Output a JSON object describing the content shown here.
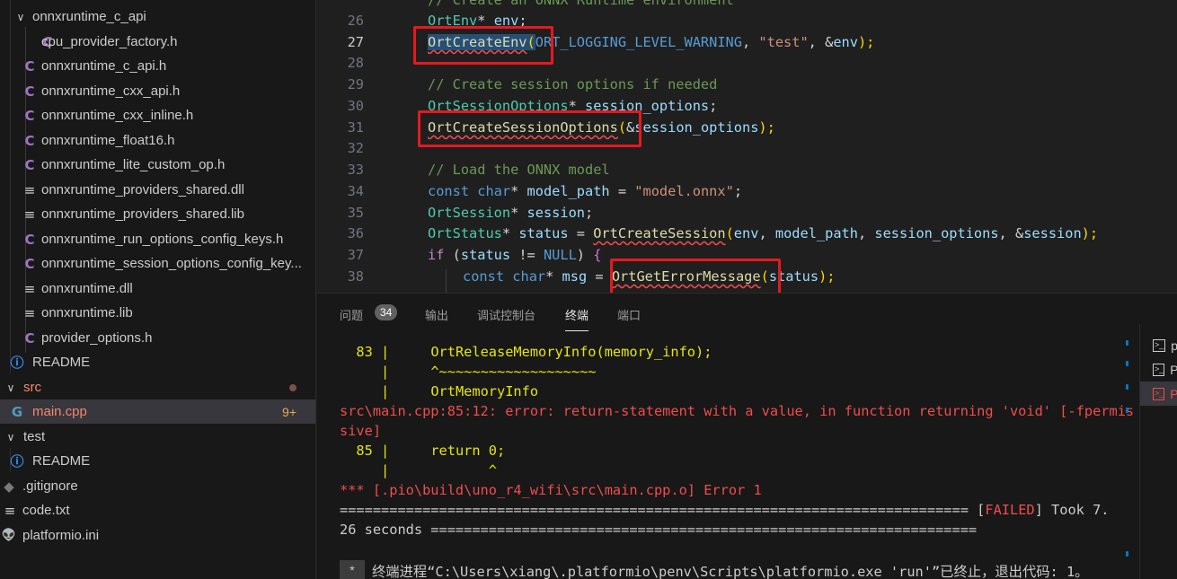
{
  "sidebar": {
    "items": [
      {
        "label": "onnxruntime_c_api",
        "kind": "folder-open",
        "icon": "chevron-down-icon"
      },
      {
        "label": "cpu_provider_factory.h",
        "kind": "c"
      },
      {
        "label": "onnxruntime_c_api.h",
        "kind": "c"
      },
      {
        "label": "onnxruntime_cxx_api.h",
        "kind": "c"
      },
      {
        "label": "onnxruntime_cxx_inline.h",
        "kind": "c"
      },
      {
        "label": "onnxruntime_float16.h",
        "kind": "c"
      },
      {
        "label": "onnxruntime_lite_custom_op.h",
        "kind": "c"
      },
      {
        "label": "onnxruntime_providers_shared.dll",
        "kind": "lines"
      },
      {
        "label": "onnxruntime_providers_shared.lib",
        "kind": "lines"
      },
      {
        "label": "onnxruntime_run_options_config_keys.h",
        "kind": "c"
      },
      {
        "label": "onnxruntime_session_options_config_key...",
        "kind": "c"
      },
      {
        "label": "onnxruntime.dll",
        "kind": "lines"
      },
      {
        "label": "onnxruntime.lib",
        "kind": "lines"
      },
      {
        "label": "provider_options.h",
        "kind": "c"
      },
      {
        "label": "README",
        "kind": "info"
      },
      {
        "label": "src",
        "kind": "folder-open"
      },
      {
        "label": "main.cpp",
        "kind": "cpp",
        "badge": "9+"
      },
      {
        "label": "test",
        "kind": "folder-open"
      },
      {
        "label": "README",
        "kind": "info"
      },
      {
        "label": ".gitignore",
        "kind": "git"
      },
      {
        "label": "code.txt",
        "kind": "lines"
      },
      {
        "label": "platformio.ini",
        "kind": "pio"
      }
    ],
    "c_glyph": "C",
    "lines_glyph": "≡",
    "info_glyph": "ⓘ",
    "git_glyph": "◆",
    "pio_glyph": "👽",
    "cpp_glyph": "G",
    "chevron_down": "∨"
  },
  "editor": {
    "lines": [
      {
        "n": "26",
        "t1": "OrtEnv",
        "t2": "* ",
        "t3": "env",
        "t4": ";"
      },
      {
        "n": "27",
        "fn": "OrtCreateEnv",
        "p1": "(",
        "macro": "ORT_LOGGING_LEVEL_WARNING",
        "c1": ", ",
        "s": "\"test\"",
        "c2": ", &",
        "v": "env",
        "p2": ");"
      },
      {
        "n": "28"
      },
      {
        "n": "29",
        "cm": "// Create session options if needed"
      },
      {
        "n": "30",
        "t1": "OrtSessionOptions",
        "t2": "* ",
        "t3": "session_options",
        "t4": ";"
      },
      {
        "n": "31",
        "fn": "OrtCreateSessionOptions",
        "p1": "(",
        "c1": "&",
        "v": "session_options",
        "p2": ");"
      },
      {
        "n": "32"
      },
      {
        "n": "33",
        "cm": "// Load the ONNX model"
      },
      {
        "n": "34",
        "kw": "const",
        "ty": " char",
        "op": "* ",
        "v": "model_path",
        "eq": " = ",
        "s": "\"model.onnx\"",
        "end": ";"
      },
      {
        "n": "35",
        "t1": "OrtSession",
        "t2": "* ",
        "t3": "session",
        "t4": ";"
      },
      {
        "n": "36",
        "t1": "OrtStatus",
        "t2": "* ",
        "t3": "status",
        "eq": " = ",
        "fn": "OrtCreateSession",
        "p1": "(",
        "a1": "env",
        "a2": ", ",
        "a3": "model_path",
        "a4": ", ",
        "a5": "session_options",
        "a6": ", &",
        "a7": "session",
        "p2": ");"
      },
      {
        "n": "37",
        "ctrl": "if",
        "sp": " (",
        "v": "status",
        "op": " != ",
        "mac": "NULL",
        "cl": ") ",
        "br": "{"
      },
      {
        "n": "38",
        "kw": "const",
        "ty": " char",
        "op": "* ",
        "v": "msg",
        "eq": " = ",
        "fn": "OrtGetErrorMessage",
        "p1": "(",
        "a1": "status",
        "p2": ");"
      }
    ],
    "top_comment": "// Create an ONNX Runtime environment"
  },
  "panel": {
    "tabs": [
      "问题",
      "输出",
      "调试控制台",
      "终端",
      "端口"
    ],
    "problems_count": "34",
    "active_tab": "终端",
    "terminal": {
      "l1_num": "  83",
      "l1_bar": " |",
      "l1_code": "     OrtReleaseMemoryInfo(memory_info);",
      "l2_bar": "     |",
      "l2_code": "     ^~~~~~~~~~~~~~~~~~~~",
      "l3_bar": "     |",
      "l3_code": "     OrtMemoryInfo",
      "l4": "src\\main.cpp:85:12: error: return-statement with a value, in function returning 'void' [-fpermis",
      "l5": "sive]",
      "l6_num": "  85",
      "l6_bar": " |",
      "l6_code": "     return 0;",
      "l7_bar": "     |",
      "l7_code": "            ^",
      "l8": "*** [.pio\\build\\uno_r4_wifi\\src\\main.cpp.o] Error 1",
      "l9a": "============================================================================ ",
      "l9b": "[",
      "l9c": "FAILED",
      "l9d": "]",
      "l9e": " Took 7.",
      "l10": "26 seconds ==================================================================",
      "finish_marker": "*",
      "finish": "终端进程“C:\\Users\\xiang\\.platformio\\penv\\Scripts\\platformio.exe 'run'”已终止，退出代码: 1。"
    },
    "terminal_list": [
      {
        "label": "p"
      },
      {
        "label": "P"
      },
      {
        "label": "P"
      }
    ],
    "terminal_glyph": ">_"
  }
}
